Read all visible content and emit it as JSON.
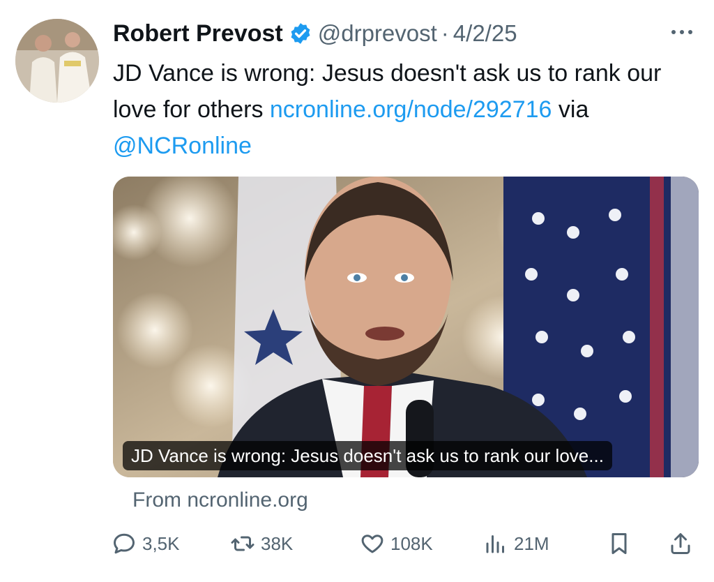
{
  "author": {
    "name": "Robert Prevost",
    "handle": "@drprevost",
    "separator": "·",
    "date": "4/2/25"
  },
  "tweet": {
    "text_plain": "JD Vance is wrong: Jesus doesn't ask us to rank our love for others ",
    "link_url": "ncronline.org/node/292716",
    "via_text": " via ",
    "mention": "@NCRonline"
  },
  "media": {
    "caption": "JD Vance is wrong: Jesus doesn't ask us to rank our love..."
  },
  "source_label": "From ncronline.org",
  "actions": {
    "replies": "3,5K",
    "reposts": "38K",
    "likes": "108K",
    "views": "21M"
  },
  "colors": {
    "link": "#1d9bf0",
    "secondary_text": "#536471",
    "verified_badge": "#1d9bf0"
  },
  "icons": [
    "verified-badge-icon",
    "more-icon",
    "reply-icon",
    "repost-icon",
    "like-icon",
    "views-icon",
    "bookmark-icon",
    "share-icon"
  ]
}
